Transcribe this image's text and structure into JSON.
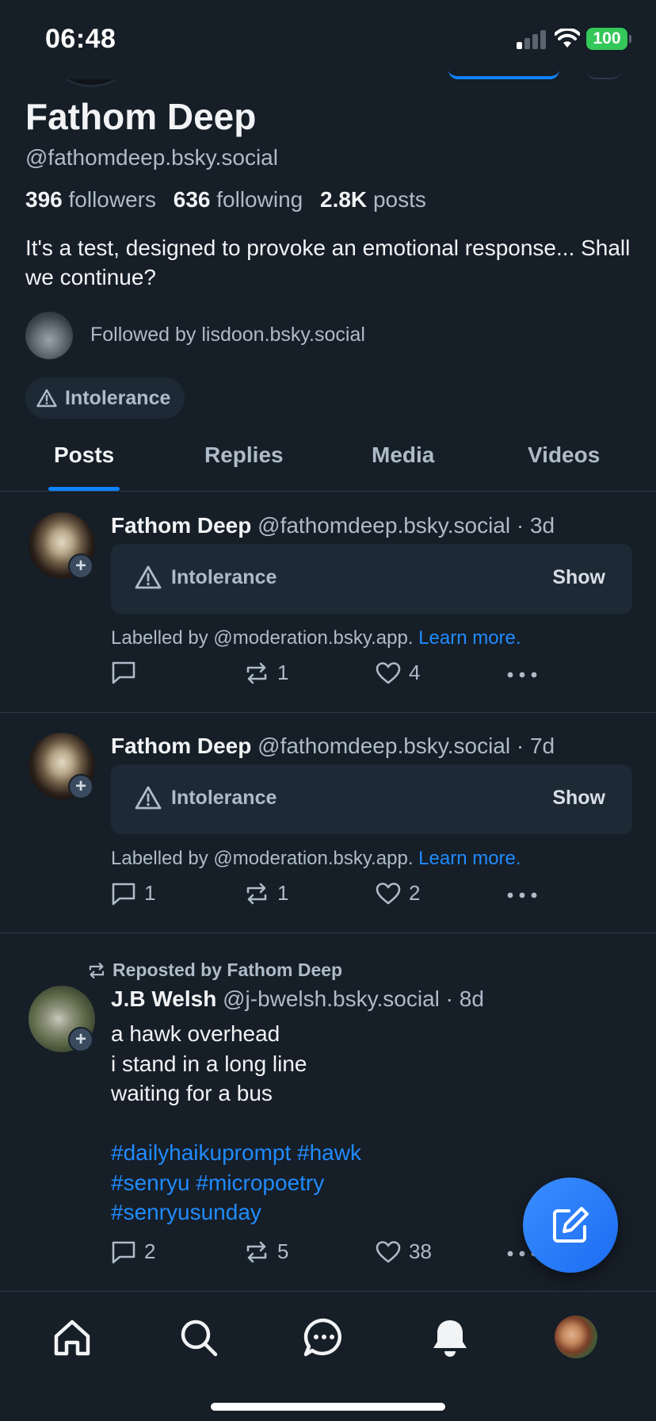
{
  "status_bar": {
    "time": "06:48",
    "battery": "100"
  },
  "profile": {
    "name": "Fathom Deep",
    "handle": "@fathomdeep.bsky.social",
    "followers_count": "396",
    "followers_label": "followers",
    "following_count": "636",
    "following_label": "following",
    "posts_count": "2.8K",
    "posts_label": "posts",
    "bio": "It's a test, designed to provoke an emotional response... Shall we continue?",
    "followed_by": "Followed by lisdoon.bsky.social",
    "label": "Intolerance"
  },
  "tabs": [
    {
      "label": "Posts"
    },
    {
      "label": "Replies"
    },
    {
      "label": "Media"
    },
    {
      "label": "Videos"
    }
  ],
  "posts": [
    {
      "author": "Fathom Deep",
      "handle": "@fathomdeep.bsky.social",
      "time": "· 3d",
      "warning": "Intolerance",
      "show_label": "Show",
      "labelled_by": "Labelled by @moderation.bsky.app.",
      "learn_more": "Learn more.",
      "replies": "",
      "reposts": "1",
      "likes": "4"
    },
    {
      "author": "Fathom Deep",
      "handle": "@fathomdeep.bsky.social",
      "time": "· 7d",
      "warning": "Intolerance",
      "show_label": "Show",
      "labelled_by": "Labelled by @moderation.bsky.app.",
      "learn_more": "Learn more.",
      "replies": "1",
      "reposts": "1",
      "likes": "2"
    },
    {
      "reposted_by": "Reposted by Fathom Deep",
      "author": "J.B Welsh",
      "handle": "@j-bwelsh.bsky.social",
      "time": "· 8d",
      "text": "a hawk overhead\ni stand in a long line\nwaiting for a bus",
      "tags": [
        "#dailyhaikuprompt",
        "#hawk",
        "#senryu",
        "#micropoetry",
        "#senryusunday"
      ],
      "replies": "2",
      "reposts": "5",
      "likes": "38"
    }
  ],
  "icons": {
    "nav": [
      "home-icon",
      "search-icon",
      "chat-icon",
      "bell-icon",
      "avatar"
    ],
    "fab": "compose-icon"
  },
  "colors": {
    "background": "#161e27",
    "accent": "#1083fe",
    "link": "#208bfe",
    "muted_text": "#aebbc9",
    "card": "#1e2936"
  }
}
